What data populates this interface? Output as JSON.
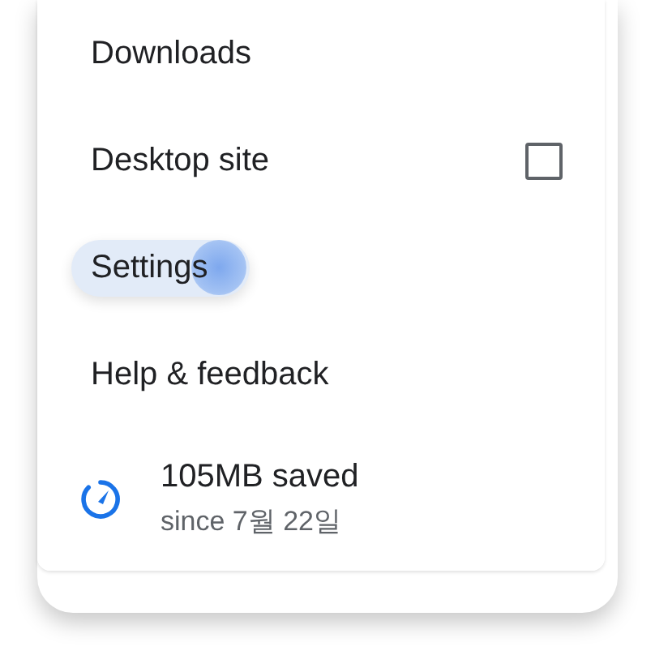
{
  "menu": {
    "items": [
      {
        "kind": "plain",
        "label": "Downloads",
        "pressed": false
      },
      {
        "kind": "checkbox",
        "label": "Desktop site",
        "checked": false,
        "pressed": false
      },
      {
        "kind": "plain",
        "label": "Settings",
        "pressed": true
      },
      {
        "kind": "plain",
        "label": "Help & feedback",
        "pressed": false
      },
      {
        "kind": "savings",
        "label": "105MB saved",
        "sublabel": "since 7월 22일",
        "pressed": false
      }
    ]
  }
}
